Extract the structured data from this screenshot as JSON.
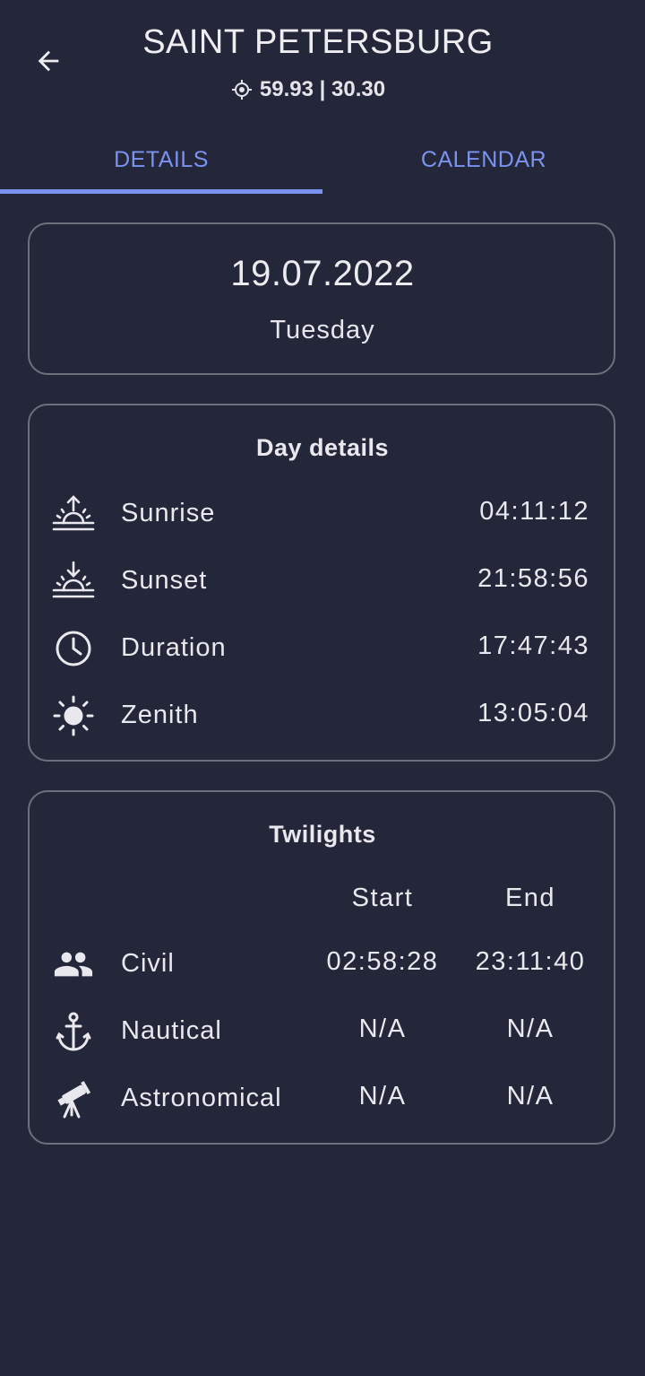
{
  "header": {
    "title": "SAINT PETERSBURG",
    "coordinates": "59.93 | 30.30",
    "icons": {
      "back": "arrow-left-icon",
      "location": "gps-location-icon"
    }
  },
  "tabs": [
    {
      "label": "DETAILS",
      "selected": true
    },
    {
      "label": "CALENDAR",
      "selected": false
    }
  ],
  "date_card": {
    "date": "19.07.2022",
    "weekday": "Tuesday"
  },
  "day_details": {
    "title": "Day details",
    "rows": [
      {
        "icon": "sunrise-icon",
        "label": "Sunrise",
        "value": "04:11:12"
      },
      {
        "icon": "sunset-icon",
        "label": "Sunset",
        "value": "21:58:56"
      },
      {
        "icon": "clock-icon",
        "label": "Duration",
        "value": "17:47:43"
      },
      {
        "icon": "sun-icon",
        "label": "Zenith",
        "value": "13:05:04"
      }
    ]
  },
  "twilights": {
    "title": "Twilights",
    "columns": {
      "start": "Start",
      "end": "End"
    },
    "rows": [
      {
        "icon": "people-icon",
        "label": "Civil",
        "start": "02:58:28",
        "end": "23:11:40"
      },
      {
        "icon": "anchor-icon",
        "label": "Nautical",
        "start": "N/A",
        "end": "N/A"
      },
      {
        "icon": "telescope-icon",
        "label": "Astronomical",
        "start": "N/A",
        "end": "N/A"
      }
    ]
  },
  "colors": {
    "background": "#24273a",
    "accent": "#7b93f0",
    "card_border": "#6e6f7c",
    "text": "#ececf0"
  }
}
